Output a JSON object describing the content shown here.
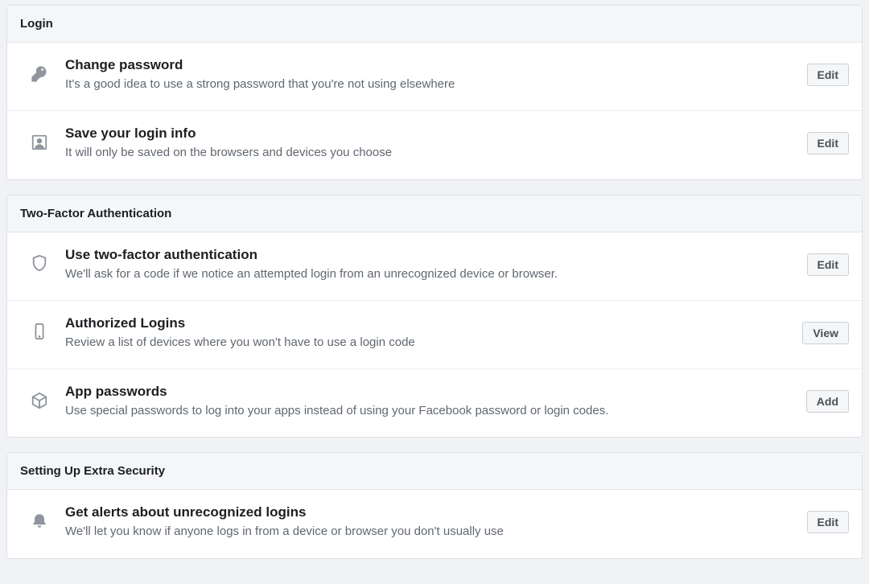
{
  "sections": [
    {
      "header": "Login",
      "items": [
        {
          "icon": "key",
          "title": "Change password",
          "desc": "It's a good idea to use a strong password that you're not using elsewhere",
          "button": "Edit"
        },
        {
          "icon": "person-square",
          "title": "Save your login info",
          "desc": "It will only be saved on the browsers and devices you choose",
          "button": "Edit"
        }
      ]
    },
    {
      "header": "Two-Factor Authentication",
      "items": [
        {
          "icon": "shield",
          "title": "Use two-factor authentication",
          "desc": "We'll ask for a code if we notice an attempted login from an unrecognized device or browser.",
          "button": "Edit"
        },
        {
          "icon": "phone",
          "title": "Authorized Logins",
          "desc": "Review a list of devices where you won't have to use a login code",
          "button": "View"
        },
        {
          "icon": "box",
          "title": "App passwords",
          "desc": "Use special passwords to log into your apps instead of using your Facebook password or login codes.",
          "button": "Add"
        }
      ]
    },
    {
      "header": "Setting Up Extra Security",
      "items": [
        {
          "icon": "bell",
          "title": "Get alerts about unrecognized logins",
          "desc": "We'll let you know if anyone logs in from a device or browser you don't usually use",
          "button": "Edit"
        }
      ]
    }
  ]
}
